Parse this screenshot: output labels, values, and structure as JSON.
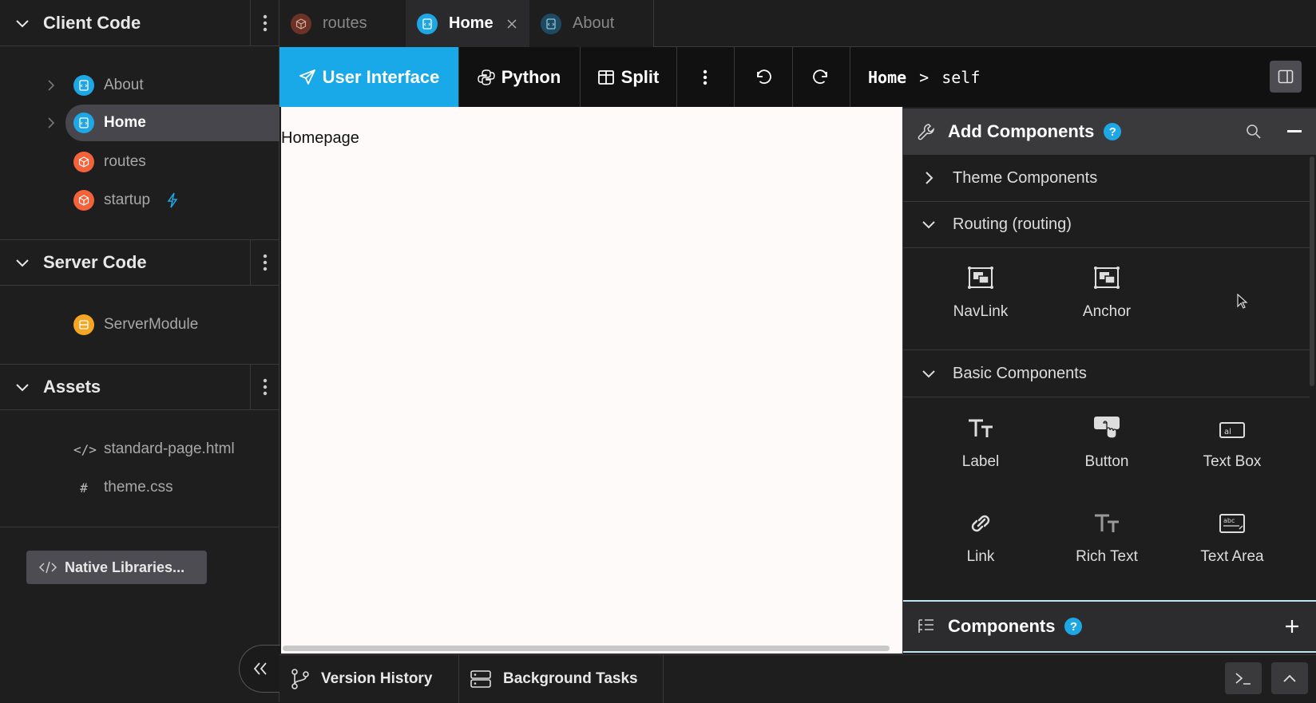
{
  "sidebar": {
    "client_code": {
      "title": "Client Code",
      "items": [
        {
          "label": "About",
          "icon": "form-icon",
          "color": "#1ea7e5"
        },
        {
          "label": "Home",
          "icon": "form-icon",
          "color": "#1ea7e5"
        },
        {
          "label": "routes",
          "icon": "module-icon",
          "color": "#f4623a"
        },
        {
          "label": "startup",
          "icon": "module-icon",
          "color": "#f4623a",
          "badge_icon": "lightning-icon"
        }
      ],
      "selected": "Home"
    },
    "server_code": {
      "title": "Server Code",
      "items": [
        {
          "label": "ServerModule",
          "icon": "server-module-icon",
          "color": "#f5a623"
        }
      ]
    },
    "assets": {
      "title": "Assets",
      "items": [
        {
          "label": "standard-page.html",
          "symbol": "</>"
        },
        {
          "label": "theme.css",
          "symbol": "#"
        }
      ]
    },
    "native_libraries_label": "Native Libraries..."
  },
  "tabs": [
    {
      "label": "routes",
      "icon": "module-icon",
      "active": false
    },
    {
      "label": "Home",
      "icon": "form-icon",
      "active": true,
      "closable": true
    },
    {
      "label": "About",
      "icon": "form-icon",
      "active": false
    }
  ],
  "toolbar": {
    "user_interface": "User Interface",
    "python": "Python",
    "split": "Split",
    "breadcrumb_form": "Home",
    "breadcrumb_sep": ">",
    "breadcrumb_item": "self",
    "accent": "#1aa9e8"
  },
  "canvas": {
    "text": "Homepage"
  },
  "add_components": {
    "title": "Add Components",
    "help": "?",
    "groups": [
      {
        "label": "Theme Components",
        "expanded": false
      },
      {
        "label": "Routing (routing)",
        "expanded": true,
        "components": [
          "NavLink",
          "Anchor"
        ]
      },
      {
        "label": "Basic Components",
        "expanded": true,
        "components": [
          "Label",
          "Button",
          "Text Box",
          "Link",
          "Rich Text",
          "Text Area"
        ]
      }
    ]
  },
  "components_panel": {
    "title": "Components",
    "help": "?"
  },
  "bottom": {
    "version_history": "Version History",
    "background_tasks": "Background Tasks"
  }
}
